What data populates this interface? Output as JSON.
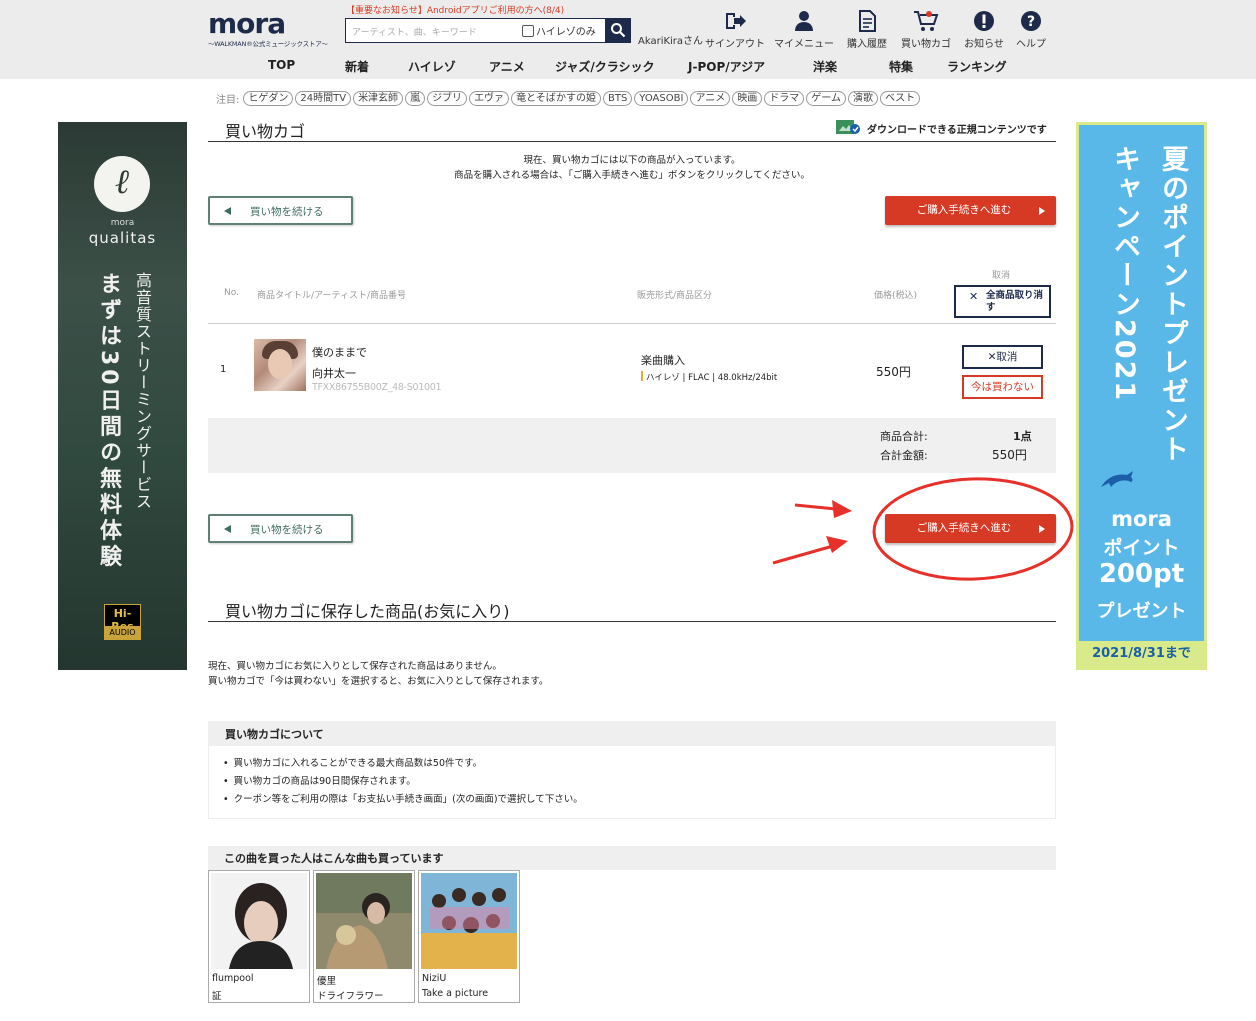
{
  "header": {
    "logo_text": "mora",
    "logo_sub": "〜WALKMAN®公式ミュージックストア〜",
    "notice": "【重要なお知らせ】Androidアプリご利用の方へ(8/4)",
    "search_placeholder": "アーティスト、曲、キーワード",
    "hires_only_label": "ハイレゾのみ",
    "username": "AkariKiraさん",
    "nav": [
      {
        "label": "サインアウト",
        "icon": "signout-icon"
      },
      {
        "label": "マイメニュー",
        "icon": "user-icon"
      },
      {
        "label": "購入履歴",
        "icon": "history-icon"
      },
      {
        "label": "買い物カゴ",
        "icon": "cart-icon"
      },
      {
        "label": "お知らせ",
        "icon": "info-icon"
      },
      {
        "label": "ヘルプ",
        "icon": "help-icon"
      }
    ],
    "categories": [
      "TOP",
      "新着",
      "ハイレゾ",
      "アニメ",
      "ジャズ/クラシック",
      "J-POP/アジア",
      "洋楽",
      "特集",
      "ランキング"
    ]
  },
  "tags": {
    "label": "注目:",
    "items": [
      "ヒゲダン",
      "24時間TV",
      "米津玄師",
      "嵐",
      "ジブリ",
      "エヴァ",
      "竜とそばかすの姫",
      "BTS",
      "YOASOBI",
      "アニメ",
      "映画",
      "ドラマ",
      "ゲーム",
      "演歌",
      "ベスト"
    ]
  },
  "banner_left": {
    "brand_small": "mora",
    "brand": "qualitas",
    "line1": "高音質ストリーミングサービス",
    "line2": "まずは30日間の無料体験",
    "hires_top": "Hi-Res",
    "hires_bottom": "AUDIO"
  },
  "banner_right": {
    "line1": "夏のポイントプレゼント",
    "line2": "キャンペーン2021",
    "mora": "mora",
    "point": "ポイント",
    "amount": "200pt",
    "present": "プレゼント",
    "date": "2021/8/31まで"
  },
  "cart": {
    "title": "買い物カゴ",
    "download_note": "ダウンロードできる正規コンテンツです",
    "lead1": "現在、買い物カゴには以下の商品が入っています。",
    "lead2": "商品を購入される場合は、「ご購入手続きへ進む」ボタンをクリックしてください。",
    "continue_label": "買い物を続ける",
    "checkout_label": "ご購入手続きへ進む",
    "columns": {
      "no": "No.",
      "title": "商品タイトル/アーティスト/商品番号",
      "type": "販売形式/商品区分",
      "price": "価格(税込)",
      "cancel": "取消"
    },
    "remove_all_label": "全商品取り消す",
    "items": [
      {
        "no": "1",
        "title": "僕のままで",
        "artist": "向井太一",
        "code": "TFXX86755B00Z_48-S01001",
        "type": "楽曲購入",
        "format": "ハイレゾ | FLAC | 48.0kHz/24bit",
        "price": "550円",
        "remove_label": "取消",
        "later_label": "今は買わない"
      }
    ],
    "summary": {
      "count_label": "商品合計:",
      "count_value": "1点",
      "total_label": "合計金額:",
      "total_value": "550円"
    }
  },
  "favorites": {
    "title": "買い物カゴに保存した商品(お気に入り)",
    "note1": "現在、買い物カゴにお気に入りとして保存された商品はありません。",
    "note2": "買い物カゴで「今は買わない」を選択すると、お気に入りとして保存されます。"
  },
  "about": {
    "title": "買い物カゴについて",
    "items": [
      "買い物カゴに入れることができる最大商品数は50件です。",
      "買い物カゴの商品は90日間保存されます。",
      "クーポン等をご利用の際は「お支払い手続き画面」(次の画面)で選択して下さい。"
    ]
  },
  "recommend": {
    "title": "この曲を買った人はこんな曲も買っています",
    "items": [
      {
        "artist": "flumpool",
        "title": "証"
      },
      {
        "artist": "優里",
        "title": "ドライフラワー"
      },
      {
        "artist": "NiziU",
        "title": "Take a picture"
      }
    ]
  },
  "colors": {
    "accent_red": "#d63a24",
    "navy": "#1e2a4a",
    "annotation_red": "#e8302a"
  }
}
